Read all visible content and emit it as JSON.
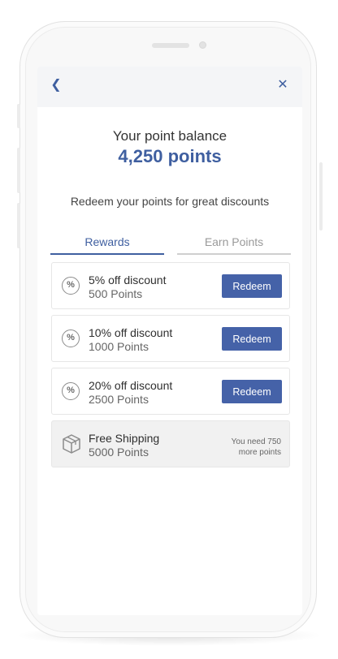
{
  "colors": {
    "accent": "#3f5fa0",
    "button": "#4562a8"
  },
  "header": {
    "back_icon": "chevron-left-icon",
    "close_icon": "close-icon",
    "back_glyph": "❮",
    "close_glyph": "✕"
  },
  "balance": {
    "title": "Your point balance",
    "points": "4,250 points"
  },
  "subtitle": "Redeem your points for great discounts",
  "tabs": [
    {
      "label": "Rewards",
      "active": true
    },
    {
      "label": "Earn Points",
      "active": false
    }
  ],
  "rewards": [
    {
      "icon": "percent-icon",
      "icon_glyph": "%",
      "title": "5%  off discount",
      "points": "500 Points",
      "button": "Redeem"
    },
    {
      "icon": "percent-icon",
      "icon_glyph": "%",
      "title": "10%  off discount",
      "points": "1000 Points",
      "button": "Redeem"
    },
    {
      "icon": "percent-icon",
      "icon_glyph": "%",
      "title": "20%  off discount",
      "points": "2500 Points",
      "button": "Redeem"
    },
    {
      "icon": "package-icon",
      "title": "Free Shipping",
      "points": "5000 Points",
      "need_line1": "You need 750",
      "need_line2": "more points"
    }
  ]
}
